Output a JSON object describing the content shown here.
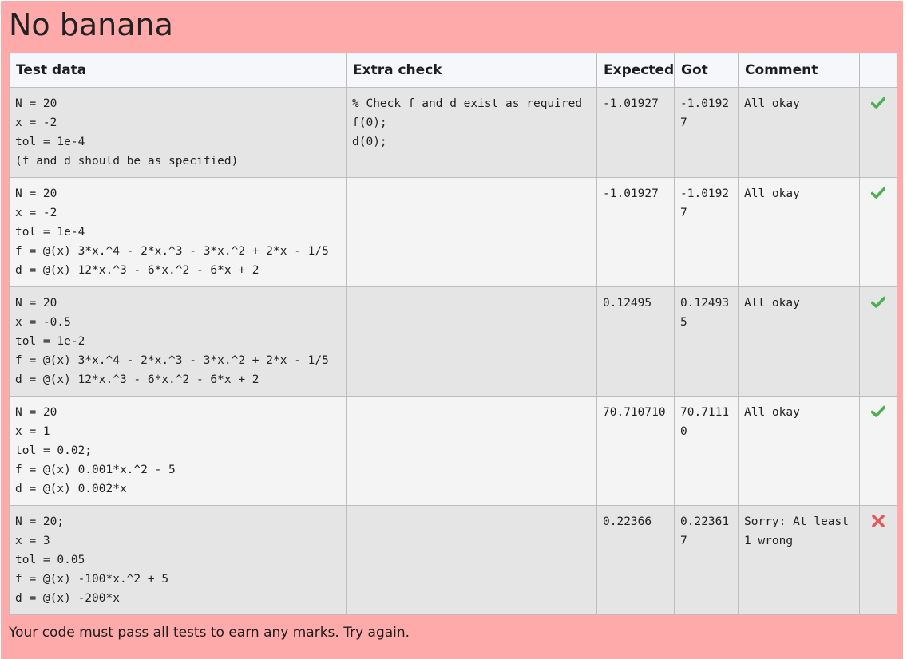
{
  "page": {
    "title": "No banana",
    "footer": "Your code must pass all tests to earn any marks. Try again."
  },
  "table": {
    "headers": {
      "test_data": "Test data",
      "extra_check": "Extra check",
      "expected": "Expected",
      "got": "Got",
      "comment": "Comment",
      "mark": ""
    },
    "rows": [
      {
        "test_data": "N = 20\nx = -2\ntol = 1e-4\n(f and d should be as specified)",
        "extra_check": "% Check f and d exist as required\nf(0);\nd(0);",
        "expected": "-1.01927",
        "got": "-1.01927",
        "comment": "All okay",
        "pass": true,
        "mark_icon": "check-icon",
        "mark_color": "#4caf50"
      },
      {
        "test_data": "N = 20\nx = -2\ntol = 1e-4\nf = @(x) 3*x.^4 - 2*x.^3 - 3*x.^2 + 2*x - 1/5\nd = @(x) 12*x.^3 - 6*x.^2 - 6*x + 2",
        "extra_check": "",
        "expected": "-1.01927",
        "got": "-1.01927",
        "comment": "All okay",
        "pass": true,
        "mark_icon": "check-icon",
        "mark_color": "#4caf50"
      },
      {
        "test_data": "N = 20\nx = -0.5\ntol = 1e-2\nf = @(x) 3*x.^4 - 2*x.^3 - 3*x.^2 + 2*x - 1/5\nd = @(x) 12*x.^3 - 6*x.^2 - 6*x + 2",
        "extra_check": "",
        "expected": "0.12495",
        "got": "0.124935",
        "comment": "All okay",
        "pass": true,
        "mark_icon": "check-icon",
        "mark_color": "#4caf50"
      },
      {
        "test_data": "N = 20\nx = 1\ntol = 0.02;\nf = @(x) 0.001*x.^2 - 5\nd = @(x) 0.002*x",
        "extra_check": "",
        "expected": "70.710710",
        "got": "70.71110",
        "comment": "All okay",
        "pass": true,
        "mark_icon": "check-icon",
        "mark_color": "#4caf50"
      },
      {
        "test_data": "N = 20;\nx = 3\ntol = 0.05\nf = @(x) -100*x.^2 + 5\nd = @(x) -200*x",
        "extra_check": "",
        "expected": "0.22366",
        "got": "0.223617",
        "comment": "Sorry: At least 1 wrong",
        "pass": false,
        "mark_icon": "cross-icon",
        "mark_color": "#e05a5a"
      }
    ]
  }
}
